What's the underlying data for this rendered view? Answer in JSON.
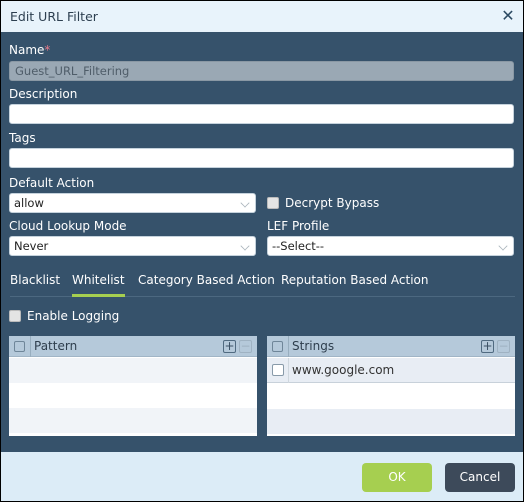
{
  "dialog": {
    "title": "Edit URL Filter",
    "close_icon": "close-icon"
  },
  "form": {
    "name_label": "Name",
    "name_required": "*",
    "name_value": "Guest_URL_Filtering",
    "description_label": "Description",
    "description_value": "",
    "tags_label": "Tags",
    "tags_value": "",
    "default_action_label": "Default Action",
    "default_action_value": "allow",
    "decrypt_bypass_label": "Decrypt Bypass",
    "decrypt_bypass_checked": false,
    "cloud_lookup_label": "Cloud Lookup Mode",
    "cloud_lookup_value": "Never",
    "lef_profile_label": "LEF Profile",
    "lef_profile_value": "--Select--"
  },
  "tabs": [
    {
      "label": "Blacklist",
      "active": false
    },
    {
      "label": "Whitelist",
      "active": true
    },
    {
      "label": "Category Based Action",
      "active": false
    },
    {
      "label": "Reputation Based Action",
      "active": false
    }
  ],
  "whitelist": {
    "enable_logging_label": "Enable Logging",
    "enable_logging_checked": false,
    "pattern_grid": {
      "header": "Pattern",
      "rows": []
    },
    "strings_grid": {
      "header": "Strings",
      "rows": [
        "www.google.com"
      ]
    },
    "add_symbol": "+",
    "remove_symbol": "−"
  },
  "footer": {
    "ok_label": "OK",
    "cancel_label": "Cancel"
  },
  "colors": {
    "accent": "#a6cf50",
    "panel": "#36526b",
    "titlebar": "#e8f3fb",
    "footer": "#dcecf7",
    "cancel": "#3d4a5a"
  }
}
